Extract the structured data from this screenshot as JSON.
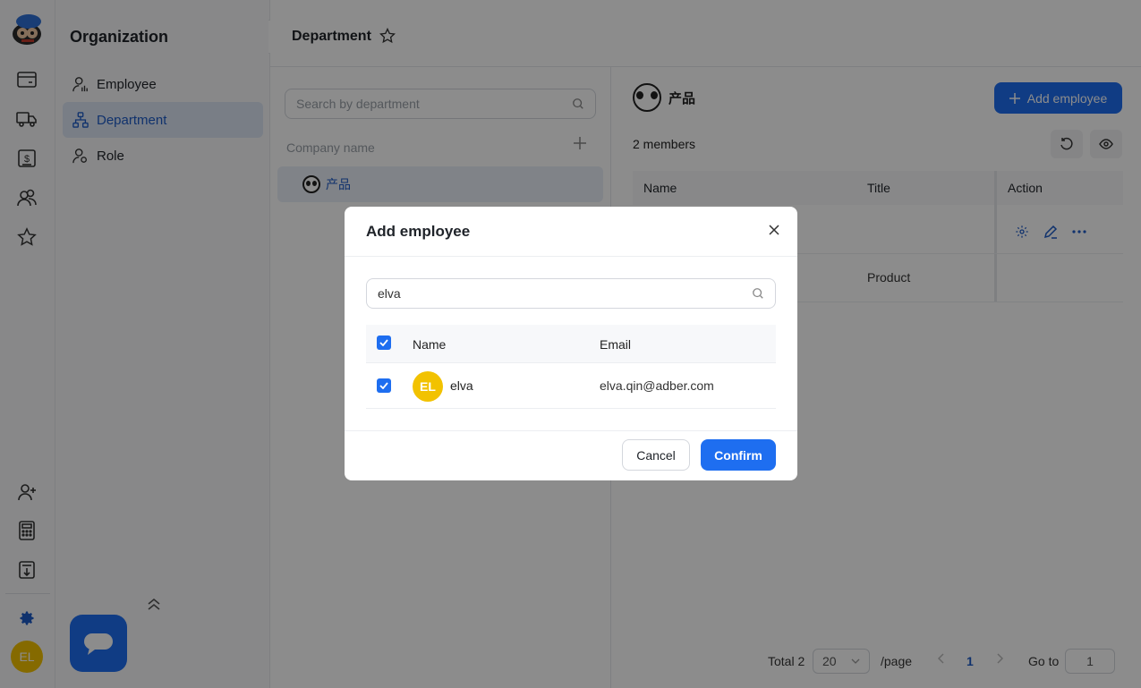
{
  "sidebar": {
    "title": "Organization",
    "items": [
      {
        "label": "Employee",
        "icon": "user-list-icon"
      },
      {
        "label": "Department",
        "icon": "org-tree-icon"
      },
      {
        "label": "Role",
        "icon": "user-key-icon"
      }
    ],
    "active_item": "Department",
    "user_avatar": "EL"
  },
  "header": {
    "title": "Department"
  },
  "dept_panel": {
    "search_placeholder": "Search by department",
    "company_label": "Company name",
    "departments": [
      {
        "name": "产品"
      }
    ]
  },
  "main": {
    "dept_name": "产品",
    "add_button": "Add employee",
    "members_count": "2 members",
    "columns": [
      "Name",
      "Title",
      "Action"
    ],
    "rows": [
      {
        "name": "",
        "title": ""
      },
      {
        "name": "",
        "title": "Product"
      }
    ],
    "pagination": {
      "total": "Total 2",
      "page_size": "20",
      "per_page": "/page",
      "current_page": "1",
      "goto_label": "Go to",
      "goto_value": "1"
    }
  },
  "modal": {
    "title": "Add employee",
    "search_value": "elva",
    "columns": {
      "name": "Name",
      "email": "Email"
    },
    "rows": [
      {
        "initials": "EL",
        "name": "elva",
        "email": "elva.qin@adber.com",
        "checked": true
      }
    ],
    "cancel_label": "Cancel",
    "confirm_label": "Confirm"
  },
  "colors": {
    "primary": "#1e6ef0",
    "active_nav_bg": "#dce6f5",
    "avatar_yellow": "#f2c200"
  }
}
